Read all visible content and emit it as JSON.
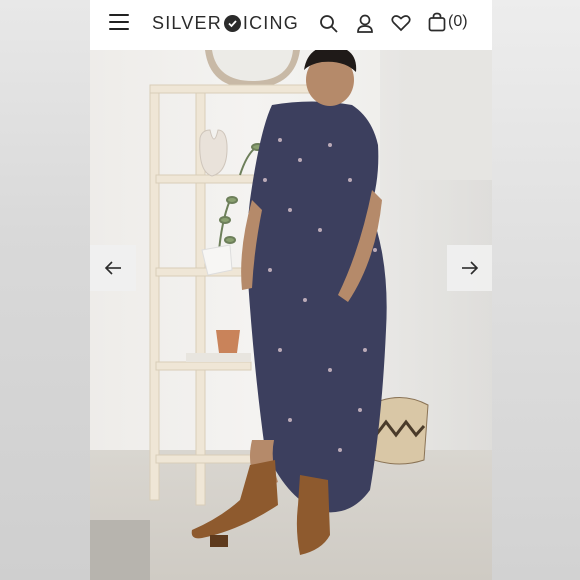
{
  "header": {
    "brand_left": "SILVER",
    "brand_right": "ICING",
    "cart_count": "(0)",
    "icons": [
      "menu-icon",
      "search-icon",
      "account-icon",
      "heart-icon",
      "shopping-bag-icon"
    ]
  },
  "gallery": {
    "prev_icon": "arrow-left-icon",
    "next_icon": "arrow-right-icon"
  },
  "colors": {
    "header_bg": "#ffffff",
    "text": "#2b2b2b",
    "arrow_bg": "#f0f0f0"
  }
}
